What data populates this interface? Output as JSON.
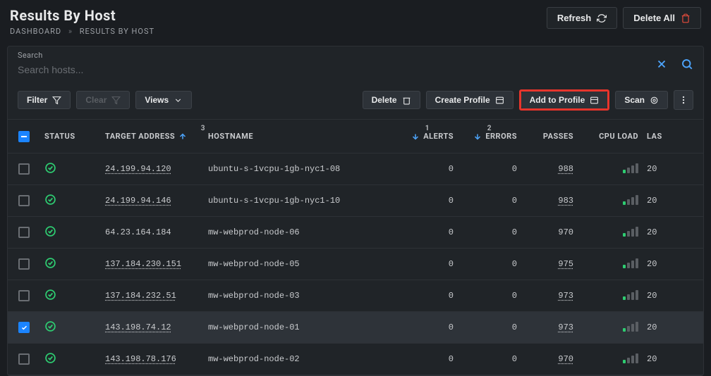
{
  "page": {
    "title": "Results By Host",
    "breadcrumb": [
      {
        "text": "DASHBOARD"
      },
      {
        "text": "RESULTS BY HOST"
      }
    ]
  },
  "actions": {
    "refresh": "Refresh",
    "deleteAll": "Delete All"
  },
  "search": {
    "label": "Search",
    "placeholder": "Search hosts..."
  },
  "toolbar": {
    "filter": "Filter",
    "clear": "Clear",
    "views": "Views",
    "delete": "Delete",
    "createProfile": "Create Profile",
    "addToProfile": "Add to Profile",
    "scan": "Scan"
  },
  "columns": {
    "status": "STATUS",
    "target": "TARGET ADDRESS",
    "target_sort_idx": "3",
    "hostname": "HOSTNAME",
    "alerts": "ALERTS",
    "alerts_sort_idx": "1",
    "errors": "ERRORS",
    "errors_sort_idx": "2",
    "passes": "PASSES",
    "cpu": "CPU LOAD",
    "last": "LAS"
  },
  "rows": [
    {
      "checked": false,
      "status": "ok",
      "addr": "24.199.94.120",
      "addr_link": true,
      "host": "ubuntu-s-1vcpu-1gb-nyc1-08",
      "alerts": "0",
      "errors": "0",
      "passes": "988",
      "passes_link": true,
      "signal": 1,
      "last": "20"
    },
    {
      "checked": false,
      "status": "ok",
      "addr": "24.199.94.146",
      "addr_link": true,
      "host": "ubuntu-s-1vcpu-1gb-nyc1-10",
      "alerts": "0",
      "errors": "0",
      "passes": "983",
      "passes_link": true,
      "signal": 1,
      "last": "20"
    },
    {
      "checked": false,
      "status": "ok",
      "addr": "64.23.164.184",
      "addr_link": false,
      "host": "mw-webprod-node-06",
      "alerts": "0",
      "errors": "0",
      "passes": "970",
      "passes_link": false,
      "signal": 1,
      "last": "20"
    },
    {
      "checked": false,
      "status": "ok",
      "addr": "137.184.230.151",
      "addr_link": true,
      "host": "mw-webprod-node-05",
      "alerts": "0",
      "errors": "0",
      "passes": "975",
      "passes_link": true,
      "signal": 1,
      "last": "20"
    },
    {
      "checked": false,
      "status": "ok",
      "addr": "137.184.232.51",
      "addr_link": true,
      "host": "mw-webprod-node-03",
      "alerts": "0",
      "errors": "0",
      "passes": "973",
      "passes_link": true,
      "signal": 1,
      "last": "20"
    },
    {
      "checked": true,
      "status": "ok",
      "addr": "143.198.74.12",
      "addr_link": true,
      "host": "mw-webprod-node-01",
      "alerts": "0",
      "errors": "0",
      "passes": "973",
      "passes_link": true,
      "signal": 1,
      "last": "20"
    },
    {
      "checked": false,
      "status": "ok",
      "addr": "143.198.78.176",
      "addr_link": true,
      "host": "mw-webprod-node-02",
      "alerts": "0",
      "errors": "0",
      "passes": "970",
      "passes_link": true,
      "signal": 1,
      "last": "20"
    }
  ]
}
